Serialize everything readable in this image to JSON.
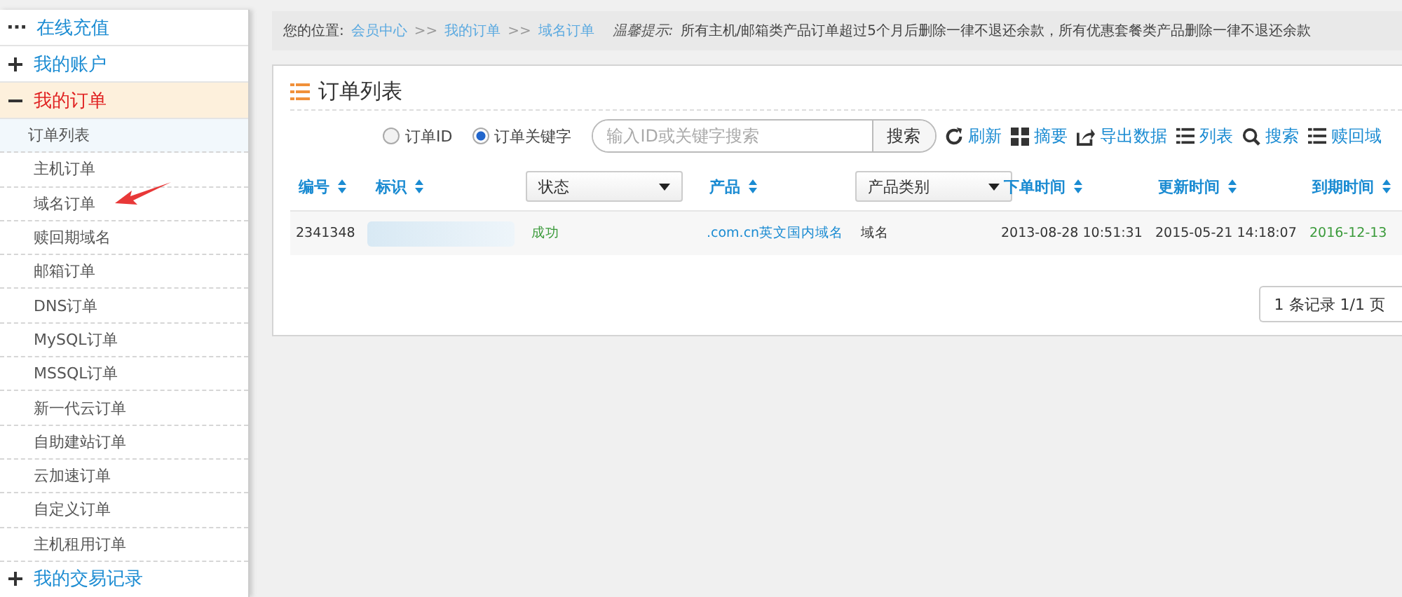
{
  "sidebar": {
    "groups": [
      {
        "kind": "link",
        "label": "在线充值"
      },
      {
        "kind": "folder",
        "label": "我的账户",
        "expanded": false
      },
      {
        "kind": "folder",
        "label": "我的订单",
        "expanded": true,
        "children": [
          {
            "label": "订单列表",
            "selected": true
          },
          {
            "label": "主机订单",
            "selected": false
          },
          {
            "label": "域名订单",
            "selected": false
          },
          {
            "label": "赎回期域名",
            "selected": false
          },
          {
            "label": "邮箱订单",
            "selected": false
          },
          {
            "label": "DNS订单",
            "selected": false
          },
          {
            "label": "MySQL订单",
            "selected": false
          },
          {
            "label": "MSSQL订单",
            "selected": false
          },
          {
            "label": "新一代云订单",
            "selected": false
          },
          {
            "label": "自助建站订单",
            "selected": false
          },
          {
            "label": "云加速订单",
            "selected": false
          },
          {
            "label": "自定义订单",
            "selected": false
          },
          {
            "label": "主机租用订单",
            "selected": false
          }
        ]
      },
      {
        "kind": "folder",
        "label": "我的交易记录",
        "expanded": false
      }
    ]
  },
  "breadcrumb": {
    "label": "您的位置:",
    "links": [
      "会员中心",
      "我的订单",
      "域名订单"
    ],
    "separator": ">>",
    "notice_label": "温馨提示:",
    "notice": "所有主机/邮箱类产品订单超过5个月后删除一律不退还余款，所有优惠套餐类产品删除一律不退还余款"
  },
  "panel": {
    "title": "订单列表",
    "search": {
      "options": [
        {
          "label": "订单ID",
          "selected": false
        },
        {
          "label": "订单关键字",
          "selected": true
        }
      ],
      "placeholder": "输入ID或关键字搜索",
      "button": "搜索"
    },
    "tools": [
      {
        "kind": "refresh",
        "label": "刷新"
      },
      {
        "kind": "grid",
        "label": "摘要"
      },
      {
        "kind": "export",
        "label": "导出数据"
      },
      {
        "kind": "list",
        "label": "列表"
      },
      {
        "kind": "search",
        "label": "搜索"
      },
      {
        "kind": "list",
        "label": "赎回域"
      }
    ],
    "columns": [
      {
        "kind": "sort",
        "label": "编号"
      },
      {
        "kind": "sort",
        "label": "标识"
      },
      {
        "kind": "dropdown",
        "label": "状态"
      },
      {
        "kind": "sort",
        "label": "产品"
      },
      {
        "kind": "dropdown",
        "label": "产品类别"
      },
      {
        "kind": "sort",
        "label": "下单时间"
      },
      {
        "kind": "sort",
        "label": "更新时间"
      },
      {
        "kind": "sort",
        "label": "到期时间"
      }
    ],
    "rows": [
      {
        "cells": [
          {
            "kind": "plain",
            "text": "2341348"
          },
          {
            "kind": "masked"
          },
          {
            "kind": "success",
            "text": "成功"
          },
          {
            "kind": "link",
            "text": ".com.cn英文国内域名"
          },
          {
            "kind": "plain",
            "text": "域名"
          },
          {
            "kind": "plain",
            "text": "2013-08-28 10:51:31"
          },
          {
            "kind": "plain",
            "text": "2015-05-21 14:18:07"
          },
          {
            "kind": "success",
            "text": "2016-12-13"
          }
        ]
      }
    ],
    "pagination": "1 条记录 1/1 页"
  }
}
